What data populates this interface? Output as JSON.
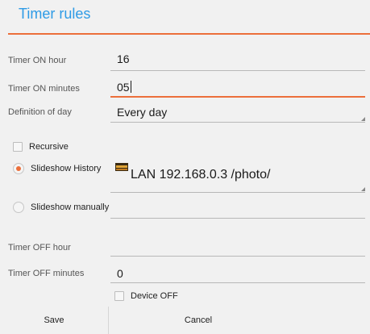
{
  "dialog": {
    "title": "Timer rules",
    "accent_color": "#2e9be6",
    "rule_color": "#ec6f3b"
  },
  "fields": {
    "timer_on_hour": {
      "label": "Timer ON hour",
      "value": "16"
    },
    "timer_on_minutes": {
      "label": "Timer ON minutes",
      "value": "05"
    },
    "definition_of_day": {
      "label": "Definition of day",
      "value": "Every day"
    },
    "timer_off_hour": {
      "label": "Timer OFF hour",
      "value": ""
    },
    "timer_off_minutes": {
      "label": "Timer OFF minutes",
      "value": "0"
    }
  },
  "options": {
    "recursive": {
      "label": "Recursive",
      "checked": false
    },
    "slideshow_history": {
      "label": "Slideshow History",
      "selected": true,
      "value": "LAN 192.168.0.3 /photo/",
      "icon": "folder-icon"
    },
    "slideshow_manually": {
      "label": "Slideshow manually",
      "selected": false,
      "value": ""
    },
    "device_off": {
      "label": "Device OFF",
      "checked": false
    }
  },
  "buttons": {
    "save": "Save",
    "cancel": "Cancel"
  }
}
